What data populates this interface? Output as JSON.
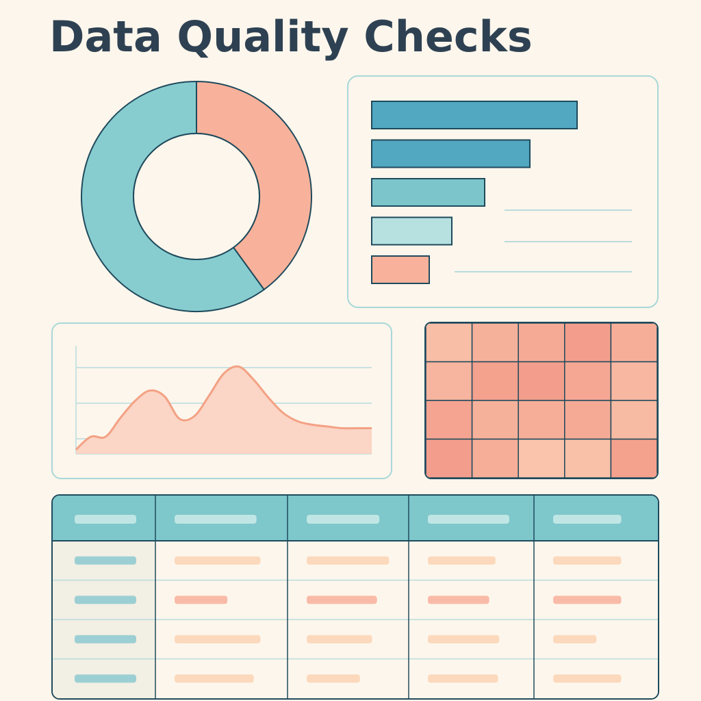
{
  "page": {
    "title": "Data Quality Checks"
  },
  "colors": {
    "background": "#fdf6ec",
    "teal": "#87cdd0",
    "deep_teal": "#52a7c1",
    "mid_teal": "#7cc6cb",
    "light_teal": "#b6e1e0",
    "salmon": "#f8b29b",
    "outline": "#1f4a5c",
    "area_fill": "#fbd5c5",
    "area_line": "#f3a184"
  },
  "chart_data": [
    {
      "type": "pie",
      "variant": "donut",
      "values": [
        60,
        40
      ],
      "colors": [
        "#87cdd0",
        "#f8b29b"
      ]
    },
    {
      "type": "bar",
      "orientation": "horizontal",
      "values": [
        100,
        77,
        55,
        39,
        28
      ],
      "xlim": [
        0,
        100
      ],
      "colors": [
        "#52a7c1",
        "#52a7c1",
        "#7cc6cb",
        "#b6e1e0",
        "#f8b29b"
      ]
    },
    {
      "type": "area",
      "x": [
        0,
        1,
        2,
        3,
        4,
        5,
        6,
        7,
        8,
        9,
        10,
        11,
        12,
        13,
        14,
        15,
        16,
        17,
        18,
        19,
        20
      ],
      "values": [
        5,
        20,
        20,
        42,
        62,
        74,
        67,
        41,
        44,
        68,
        94,
        102,
        87,
        66,
        48,
        38,
        34,
        32,
        30,
        30,
        30
      ],
      "ylim": [
        0,
        120
      ],
      "grid": true
    },
    {
      "type": "heatmap",
      "rows": 4,
      "cols": 5,
      "values": [
        [
          0.35,
          0.55,
          0.65,
          0.85,
          0.6
        ],
        [
          0.5,
          0.8,
          0.85,
          0.7,
          0.45
        ],
        [
          0.75,
          0.55,
          0.6,
          0.65,
          0.4
        ],
        [
          0.85,
          0.6,
          0.25,
          0.3,
          0.8
        ]
      ]
    },
    {
      "type": "table",
      "columns": 5,
      "rows": 4,
      "header_placeholder_widths": [
        0.6,
        0.62,
        0.6,
        0.65,
        0.55
      ],
      "cell_placeholder_widths": [
        [
          0.6,
          0.65,
          0.68,
          0.54,
          0.55
        ],
        [
          0.6,
          0.4,
          0.58,
          0.49,
          0.55
        ],
        [
          0.6,
          0.65,
          0.54,
          0.57,
          0.35
        ],
        [
          0.6,
          0.6,
          0.44,
          0.56,
          0.55
        ]
      ],
      "cell_tones": [
        [
          "teal",
          "peach",
          "peach",
          "peach",
          "peach"
        ],
        [
          "teal",
          "salmon",
          "salmon",
          "salmon",
          "salmon"
        ],
        [
          "teal",
          "peach",
          "peach",
          "peach",
          "peach"
        ],
        [
          "teal",
          "peach",
          "peach",
          "peach",
          "peach"
        ]
      ]
    }
  ]
}
